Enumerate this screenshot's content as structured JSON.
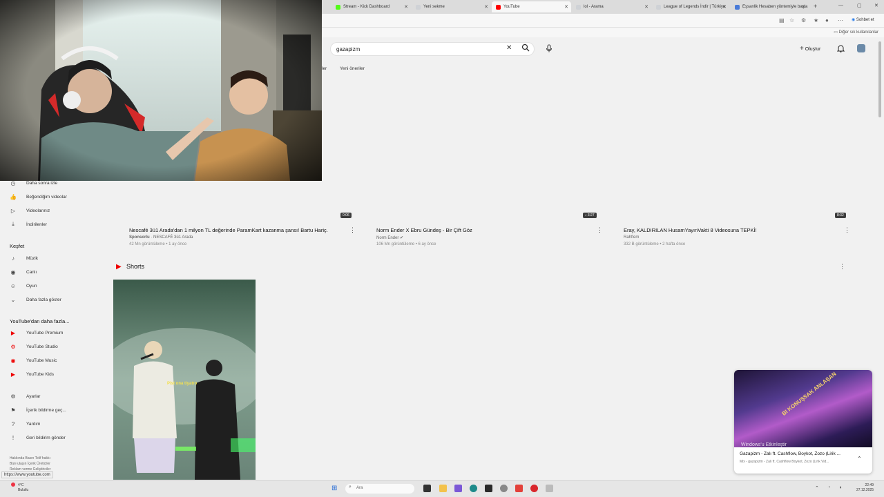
{
  "browser": {
    "tabs": [
      {
        "label": "Stream - Kick Dashboard",
        "color": "#53fc18"
      },
      {
        "label": "Yeni sekme",
        "color": "#9aa0a6"
      },
      {
        "label": "YouTube",
        "color": "#ff0000"
      },
      {
        "label": "lol - Arama",
        "color": "#9aa0a6"
      },
      {
        "label": "League of Legends İndir | Türkiye",
        "color": "#9aa0a6"
      },
      {
        "label": "Eşsanlik Hesaben yöntemiyle başla",
        "color": "#4a7bd8"
      }
    ],
    "chat_label": "Sohbet et",
    "other_favorites": "Diğer sık kullanılanlar",
    "status_url": "https://www.youtube.com"
  },
  "header": {
    "search_value": "gazapizm",
    "create_label": "Oluştur"
  },
  "chips": {
    "partial": "ler",
    "new_suggestions": "Yeni öneriler"
  },
  "sidebar": {
    "library": [
      {
        "label": "Daha sonra izle",
        "icon": "clock-icon"
      },
      {
        "label": "Beğendiğim videolar",
        "icon": "thumbs-up-icon"
      },
      {
        "label": "Videolarınız",
        "icon": "play-icon"
      },
      {
        "label": "İndirilenler",
        "icon": "download-icon"
      }
    ],
    "explore_title": "Keşfet",
    "explore": [
      {
        "label": "Müzik",
        "icon": "music-icon"
      },
      {
        "label": "Canlı",
        "icon": "live-icon"
      },
      {
        "label": "Oyun",
        "icon": "gamepad-icon"
      },
      {
        "label": "Daha fazla göster",
        "icon": "chevron-down-icon"
      }
    ],
    "more_title": "YouTube'dan daha fazla...",
    "more": [
      {
        "label": "YouTube Premium",
        "icon": "youtube-premium-icon"
      },
      {
        "label": "YouTube Studio",
        "icon": "youtube-studio-icon"
      },
      {
        "label": "YouTube Music",
        "icon": "youtube-music-icon"
      },
      {
        "label": "YouTube Kids",
        "icon": "youtube-kids-icon"
      }
    ],
    "settings": [
      {
        "label": "Ayarlar",
        "icon": "gear-icon"
      },
      {
        "label": "İçerik bildirme geç...",
        "icon": "flag-icon"
      },
      {
        "label": "Yardım",
        "icon": "help-icon"
      },
      {
        "label": "Geri bildirim gönder",
        "icon": "feedback-icon"
      }
    ],
    "footer": "Hakkında  Basın  Telif hakkı\nBize ulaşın  İçerik Üreticiler\nReklam verme  Geliştiriciler"
  },
  "videos": [
    {
      "title": "Nescafé 3ü1 Arada'dan 1 milyon TL değerinde ParamKart kazanma şansı! Bartu Hariç.",
      "channel_prefix": "Sponsorlu",
      "channel": "· NESCAFÉ 3ü1 Arada",
      "meta": "42 Mn görüntüleme • 1 ay önce",
      "duration": "0:06"
    },
    {
      "title": "Norm Ender X Ebru Gündeş - Bir Çift Göz",
      "channel_prefix": "",
      "channel": "Norm Ender",
      "meta": "106 Mn görüntüleme • 6 ay önce",
      "duration": "3:27"
    },
    {
      "title": "Eray, KALDIRILAN HusamYayınVakti 8 Videosuna TEPKİ!",
      "channel_prefix": "",
      "channel": "Rahflem",
      "meta": "332 B görüntüleme • 2 hafta önce",
      "duration": "8:32"
    }
  ],
  "shorts": {
    "title": "Shorts",
    "caption": "Pist ona tiyatro"
  },
  "miniplayer": {
    "title": "Gazapizm - Zalı ft. Cashflow, Boykot, Zozo (Lirik ...",
    "subtitle": "Mix - gazapizm - Zalı ft. Cashflow Boykot, Zozo (Lirik Vid...",
    "overlay_text": "BI KONUŞSAK ANLAŞAN",
    "activate_windows": "Windows'u Etkinleştir"
  },
  "taskbar": {
    "weather_temp": "4°C",
    "weather_desc": "Bulutlu",
    "search_placeholder": "Ara",
    "time": "22:49",
    "date": "27.12.2025"
  }
}
